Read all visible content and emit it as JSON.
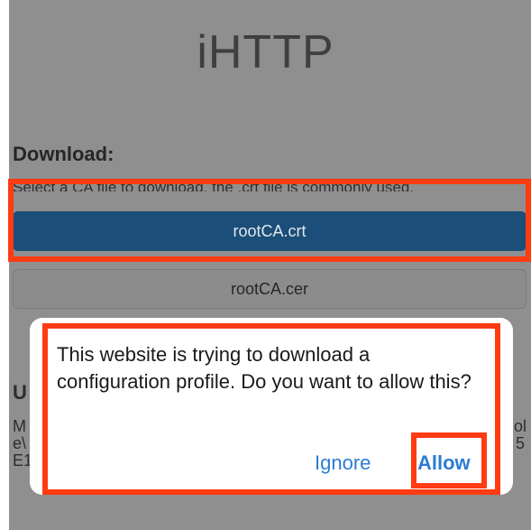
{
  "app": {
    "title": "iHTTP"
  },
  "download": {
    "heading": "Download:",
    "hint": "Select a CA file to download, the .crt file is commonly used.",
    "buttons": [
      {
        "label": "rootCA.crt",
        "style": "primary"
      },
      {
        "label": "rootCA.cer",
        "style": "secondary"
      }
    ]
  },
  "background_fragments": {
    "u": "U",
    "m": "M",
    "e": "e\\",
    "e1": "E1",
    "r1": "ol",
    "r2": "5"
  },
  "dialog": {
    "message": "This website is trying to download a configuration profile. Do you want to allow this?",
    "ignore_label": "Ignore",
    "allow_label": "Allow"
  },
  "colors": {
    "highlight": "#ff3b12",
    "primary_button": "#1b4e78",
    "action_blue": "#2b7cd3",
    "dim_background": "#8f8f8f"
  }
}
